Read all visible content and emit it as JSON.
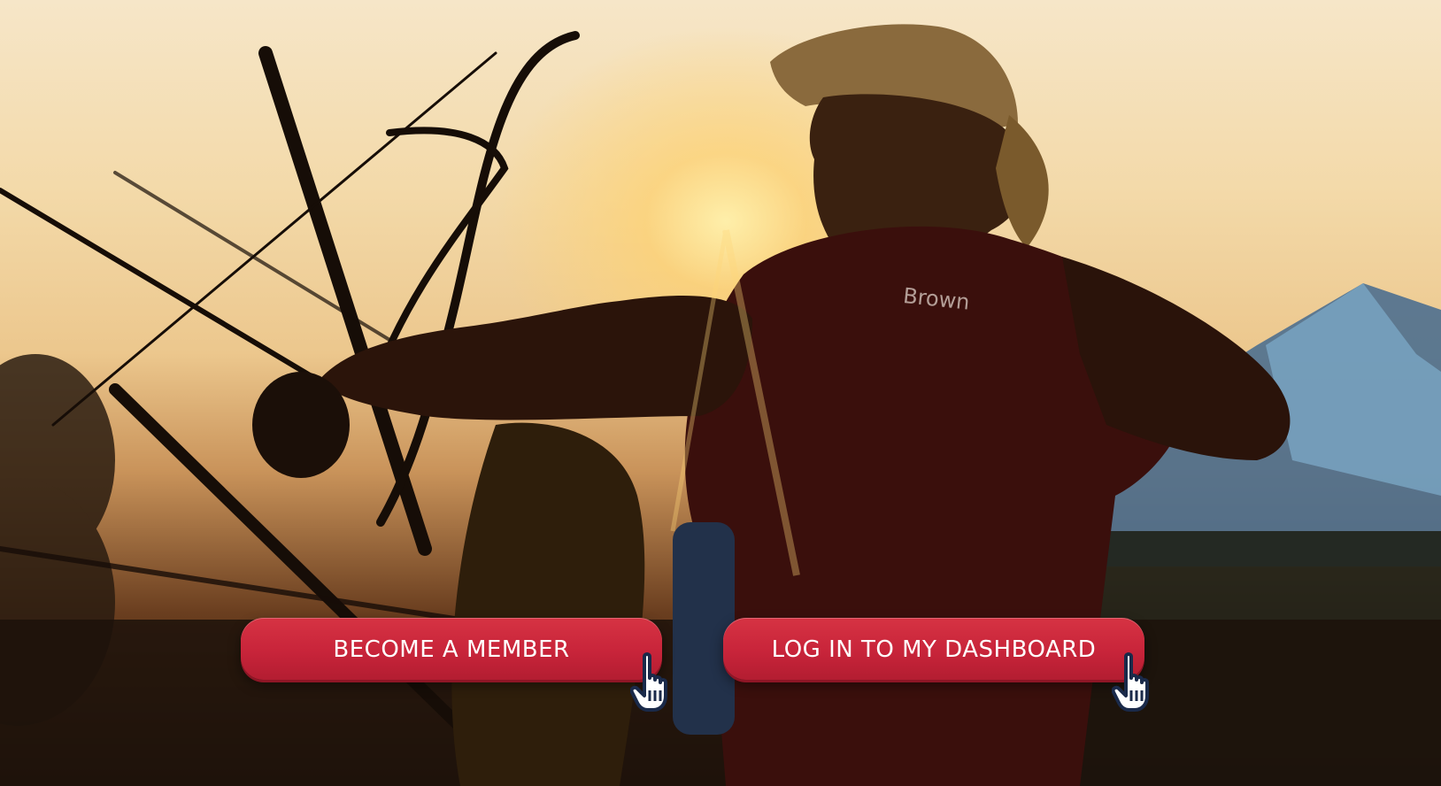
{
  "hero": {
    "jersey_text": "Brown"
  },
  "actions": {
    "become_member_label": "BECOME A MEMBER",
    "dashboard_label": "LOG IN TO MY DASHBOARD"
  },
  "icons": {
    "cursor": "hand-pointer-icon"
  },
  "colors": {
    "button_red": "#c8243a",
    "button_text": "#ffffff",
    "cursor_fill": "#ffffff",
    "cursor_outline": "#1a2a4a"
  }
}
